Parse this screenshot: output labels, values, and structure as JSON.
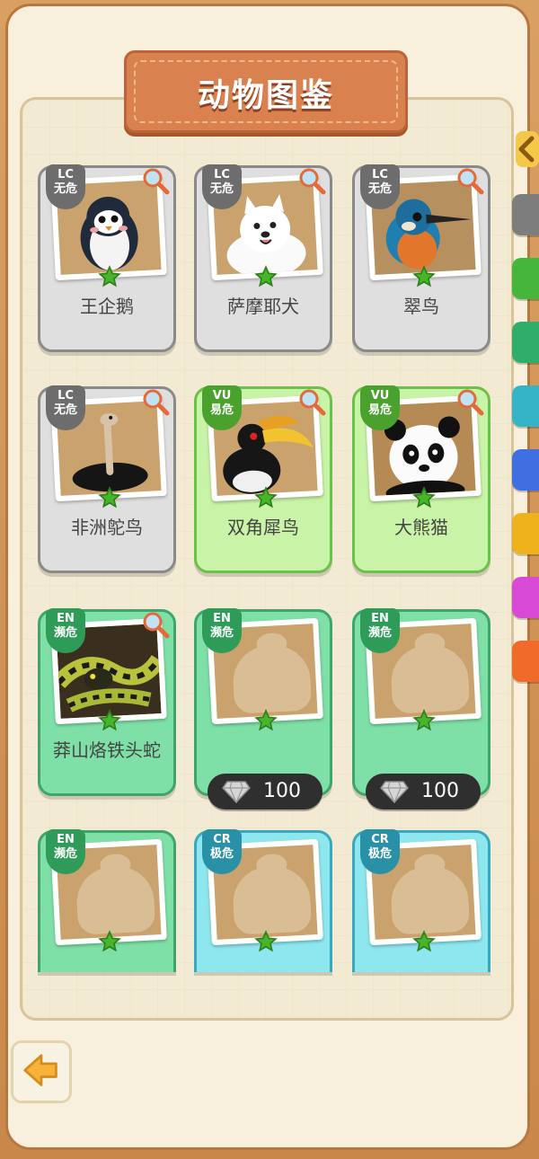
{
  "title": "动物图鉴",
  "animals": [
    {
      "name": "王企鹅",
      "status_code": "LC",
      "status_label": "无危",
      "tier": "lc",
      "icon": "penguin-icon"
    },
    {
      "name": "萨摩耶犬",
      "status_code": "LC",
      "status_label": "无危",
      "tier": "lc",
      "icon": "samoyed-icon"
    },
    {
      "name": "翠鸟",
      "status_code": "LC",
      "status_label": "无危",
      "tier": "lc",
      "icon": "kingfisher-icon"
    },
    {
      "name": "非洲鸵鸟",
      "status_code": "LC",
      "status_label": "无危",
      "tier": "lc",
      "icon": "ostrich-icon"
    },
    {
      "name": "双角犀鸟",
      "status_code": "VU",
      "status_label": "易危",
      "tier": "vu",
      "icon": "hornbill-icon"
    },
    {
      "name": "大熊猫",
      "status_code": "VU",
      "status_label": "易危",
      "tier": "vu",
      "icon": "panda-icon"
    },
    {
      "name": "莽山烙铁头蛇",
      "status_code": "EN",
      "status_label": "濒危",
      "tier": "en",
      "icon": "snake-icon"
    },
    {
      "name": "",
      "status_code": "EN",
      "status_label": "濒危",
      "tier": "en",
      "locked": true,
      "cost": "100"
    },
    {
      "name": "",
      "status_code": "EN",
      "status_label": "濒危",
      "tier": "en",
      "locked": true,
      "cost": "100"
    },
    {
      "name": "",
      "status_code": "EN",
      "status_label": "濒危",
      "tier": "en",
      "locked": true
    },
    {
      "name": "",
      "status_code": "CR",
      "status_label": "极危",
      "tier": "cr",
      "locked": true
    },
    {
      "name": "",
      "status_code": "CR",
      "status_label": "极危",
      "tier": "cr",
      "locked": true
    }
  ],
  "side_tab_colors": [
    "#7d7d7d",
    "#46b53c",
    "#2fae6a",
    "#35b4c8",
    "#3f6fe0",
    "#f0b21c",
    "#d84ad6",
    "#f06a2a"
  ],
  "icons": {
    "back": "back-arrow-icon",
    "magnifier": "magnifier-icon",
    "star": "star-icon",
    "gem": "diamond-icon"
  }
}
